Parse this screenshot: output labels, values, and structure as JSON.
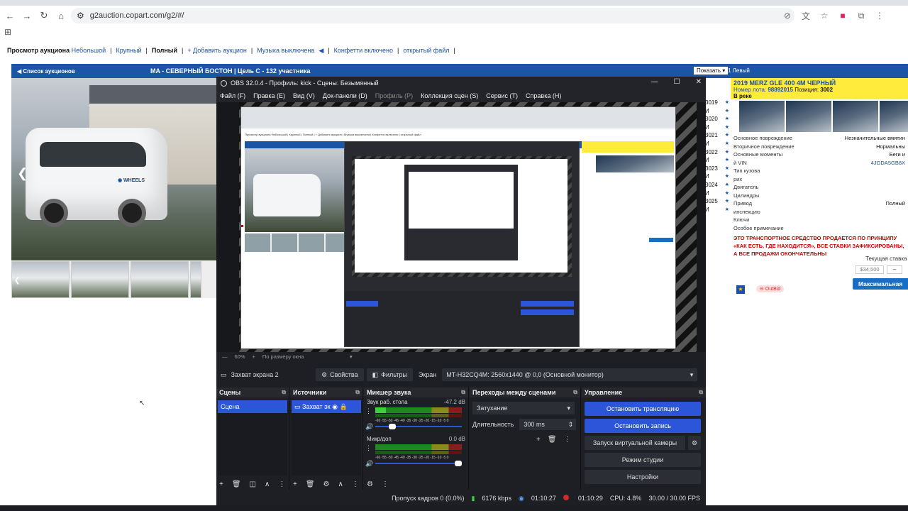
{
  "browser": {
    "url": "g2auction.copart.com/g2/#/",
    "nav_icons": [
      "back-icon",
      "forward-icon",
      "reload-icon",
      "home-icon"
    ]
  },
  "site_toolbar": {
    "view_label": "Просмотр аукциона",
    "small": "Небольшой",
    "large": "Крупный",
    "full": "Полный",
    "add_auction": "+ Добавить аукцион",
    "music": "Музыка выключена",
    "confetti": "Конфетти включено",
    "open_file": "открытый файл"
  },
  "auction_bar": {
    "back": "◀ Список аукционов",
    "title": "MA - СЕВЕРНЫЙ БОСТОН | Цель C - 132 участника",
    "show_select": "Показать",
    "left_text": "1 Левый"
  },
  "lot_panel": {
    "title": "2019 MERZ GLE 400 4M ЧЕРНЫЙ",
    "lot_label": "Номер лота:",
    "lot_number": "98892015",
    "position_label": "Позиция:",
    "position": "3002",
    "location": "В реке",
    "rows": [
      {
        "k": "Основное повреждение",
        "v": "Незначительные вмятин",
        "blue": false
      },
      {
        "k": "Вторичное повреждение",
        "v": "Нормальны",
        "blue": false
      },
      {
        "k": "Основные моменты",
        "v": "Беги и",
        "blue": false
      },
      {
        "k": "й VIN",
        "v": "4JGDA5GB8X",
        "blue": true
      },
      {
        "k": "Тип кузова",
        "v": "",
        "blue": false
      },
      {
        "k": "рих",
        "v": "",
        "blue": false
      },
      {
        "k": "Двигатель",
        "v": "",
        "blue": false
      },
      {
        "k": "Цилиндры",
        "v": "",
        "blue": false
      },
      {
        "k": "Привод",
        "v": "Полный",
        "blue": false
      },
      {
        "k": "инспекцию",
        "v": "",
        "blue": false
      },
      {
        "k": "Ключи",
        "v": "",
        "blue": false
      },
      {
        "k": "Особое примечание",
        "v": "",
        "blue": false
      }
    ],
    "notice": "ЭТО ТРАНСПОРТНОЕ СРЕДСТВО ПРОДАЕТСЯ ПО ПРИНЦИПУ «КАК ЕСТЬ, ГДЕ НАХОДИТСЯ», ВСЕ СТАВКИ ЗАФИКСИРОВАНЫ, А ВСЕ ПРОДАЖИ ОКОНЧАТЕЛЬНЫ",
    "current_bid_label": "Текущая ставка",
    "price": "$34,500",
    "minus": "–",
    "max_button": "Максимальная",
    "outbid": "OutBid"
  },
  "lot_numbers": [
    "3019",
    "И",
    "3020",
    "И",
    "3021",
    "И",
    "3022",
    "И",
    "3023",
    "И",
    "3024",
    "И",
    "3025",
    "И"
  ],
  "obs": {
    "title": "OBS 32.0.4 - Профиль: kick - Сцены: Безымянный",
    "menu": [
      "Файл (F)",
      "Правка (E)",
      "Вид (V)",
      "Док-панели (D)",
      "Профиль (P)",
      "Коллекция сцен (S)",
      "Сервис (T)",
      "Справка (H)"
    ],
    "zoom": "60%",
    "fit": "По размеру окна",
    "source_name": "Захват экрана 2",
    "properties": "Свойства",
    "filters": "Фильтры",
    "screen_label": "Экран",
    "screen_value": "MT-H32CQ4M: 2560x1440 @ 0,0 (Основной монитор)",
    "docks": {
      "scenes_title": "Сцены",
      "scene_item": "Сцена",
      "sources_title": "Источники",
      "source_item": "Захват эк",
      "mixer_title": "Микшер звука",
      "ch1_name": "Звук раб. стола",
      "ch1_db": "-47.2 dB",
      "ch1_level": 0.12,
      "ch1_fader": 0.24,
      "ch2_name": "Микр/доп",
      "ch2_db": "0.0 dB",
      "ch2_level": 0,
      "ch2_fader": 1.0,
      "scale": "-60 -55 -50 -45 -40 -35 -30 -25 -20 -15 -10 -5 0",
      "transitions_title": "Переходы между сценами",
      "transition": "Затухание",
      "duration_label": "Длительность",
      "duration": "300 ms",
      "controls_title": "Управление",
      "stop_stream": "Остановить трансляцию",
      "stop_record": "Остановить запись",
      "virtual_cam": "Запуск виртуальной камеры",
      "studio_mode": "Режим студии",
      "settings": "Настройки"
    },
    "status": {
      "dropped": "Пропуск кадров 0 (0.0%)",
      "bitrate": "6176 kbps",
      "stream_time": "01:10:27",
      "rec_time": "01:10:29",
      "cpu": "CPU: 4.8%",
      "fps": "30.00 / 30.00 FPS"
    }
  },
  "colors": {
    "accent_blue": "#2d55d9",
    "copart_blue": "#1a56a5",
    "lot_yellow": "#ffeb3b"
  }
}
